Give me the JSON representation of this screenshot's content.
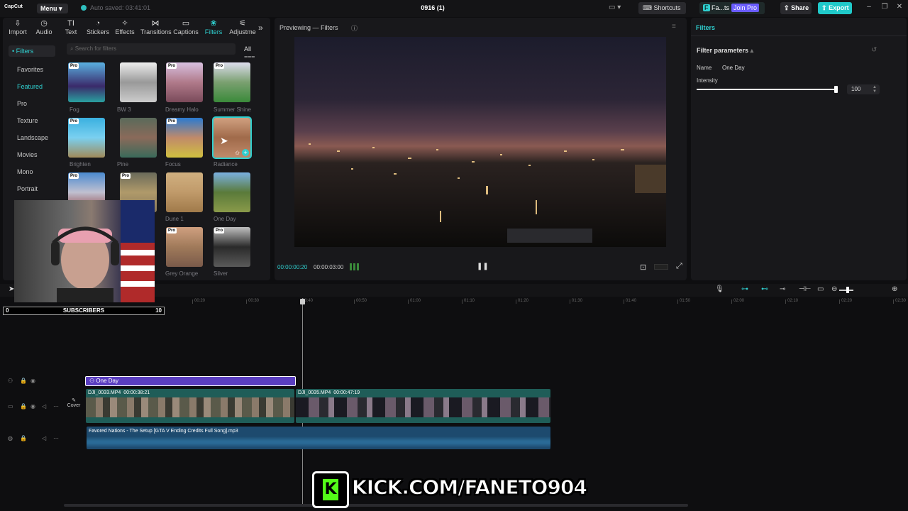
{
  "titlebar": {
    "logo": "CapCut",
    "menu_label": "Menu",
    "autosave": "Auto saved: 03:41:01",
    "project_title": "0916 (1)",
    "shortcuts": "Shortcuts",
    "pro_user": "Fa...ts",
    "join_pro": "Join Pro",
    "share": "Share",
    "export": "Export",
    "accent": "#20c9c9"
  },
  "toolbar": {
    "tools": [
      {
        "label": "Import",
        "icon": "import-icon"
      },
      {
        "label": "Audio",
        "icon": "audio-icon"
      },
      {
        "label": "Text",
        "icon": "text-icon"
      },
      {
        "label": "Stickers",
        "icon": "sticker-icon"
      },
      {
        "label": "Effects",
        "icon": "effects-icon"
      },
      {
        "label": "Transitions",
        "icon": "transitions-icon"
      },
      {
        "label": "Captions",
        "icon": "captions-icon"
      },
      {
        "label": "Filters",
        "icon": "filters-icon"
      },
      {
        "label": "Adjustme",
        "icon": "adjust-icon"
      }
    ],
    "active": "Filters"
  },
  "filters_panel": {
    "section": "• Filters",
    "categories": [
      "Favorites",
      "Featured",
      "Pro",
      "Texture",
      "Landscape",
      "Movies",
      "Mono",
      "Portrait"
    ],
    "active_category": "Featured",
    "search_placeholder": "Search for filters",
    "all_label": "All",
    "items": [
      {
        "name": "Fog",
        "pro": "Pro"
      },
      {
        "name": "BW 3",
        "pro": ""
      },
      {
        "name": "Dreamy Halo",
        "pro": "Pro"
      },
      {
        "name": "Summer Shine",
        "pro": "Pro"
      },
      {
        "name": "Brighten",
        "pro": "Pro"
      },
      {
        "name": "Pine",
        "pro": ""
      },
      {
        "name": "Focus",
        "pro": "Pro"
      },
      {
        "name": "Radiance",
        "pro": ""
      },
      {
        "name": "",
        "pro": "Pro"
      },
      {
        "name": "",
        "pro": "Pro"
      },
      {
        "name": "Dune 1",
        "pro": ""
      },
      {
        "name": "One Day",
        "pro": ""
      },
      {
        "name": "Grey Orange",
        "pro": "Pro"
      },
      {
        "name": "Silver",
        "pro": "Pro"
      }
    ]
  },
  "preview": {
    "title": "Previewing — Filters",
    "current_time": "00:00:00:20",
    "total_time": "00:00:03:00"
  },
  "details": {
    "title": "Filters",
    "params_title": "Filter parameters",
    "name_label": "Name",
    "name_value": "One Day",
    "intensity_label": "Intensity",
    "intensity_value": "100",
    "intensity_fraction": 1.0
  },
  "timeline": {
    "ruler": [
      "00:20",
      "00:30",
      "00:40",
      "00:50",
      "01:00",
      "01:10",
      "01:20",
      "01:30",
      "01:40",
      "01:50",
      "02:00",
      "02:10",
      "02:20",
      "02:30"
    ],
    "filter_clip": "One Day",
    "cover_label": "Cover",
    "clip1": {
      "name": "DJI_0033.MP4",
      "duration": "00:00:38:21"
    },
    "clip2": {
      "name": "DJI_0035.MP4",
      "duration": "00:00:47:19"
    },
    "audio": "Favored Nations - The Setup [GTA V Ending Credits Full Song].mp3"
  },
  "overlay": {
    "subs_start": "0",
    "subs_label": "SUBSCRIBERS",
    "subs_end": "10",
    "kick_text": "KICK.COM/FANETO904",
    "kick_k": "K",
    "kick_color": "#53fc18"
  }
}
